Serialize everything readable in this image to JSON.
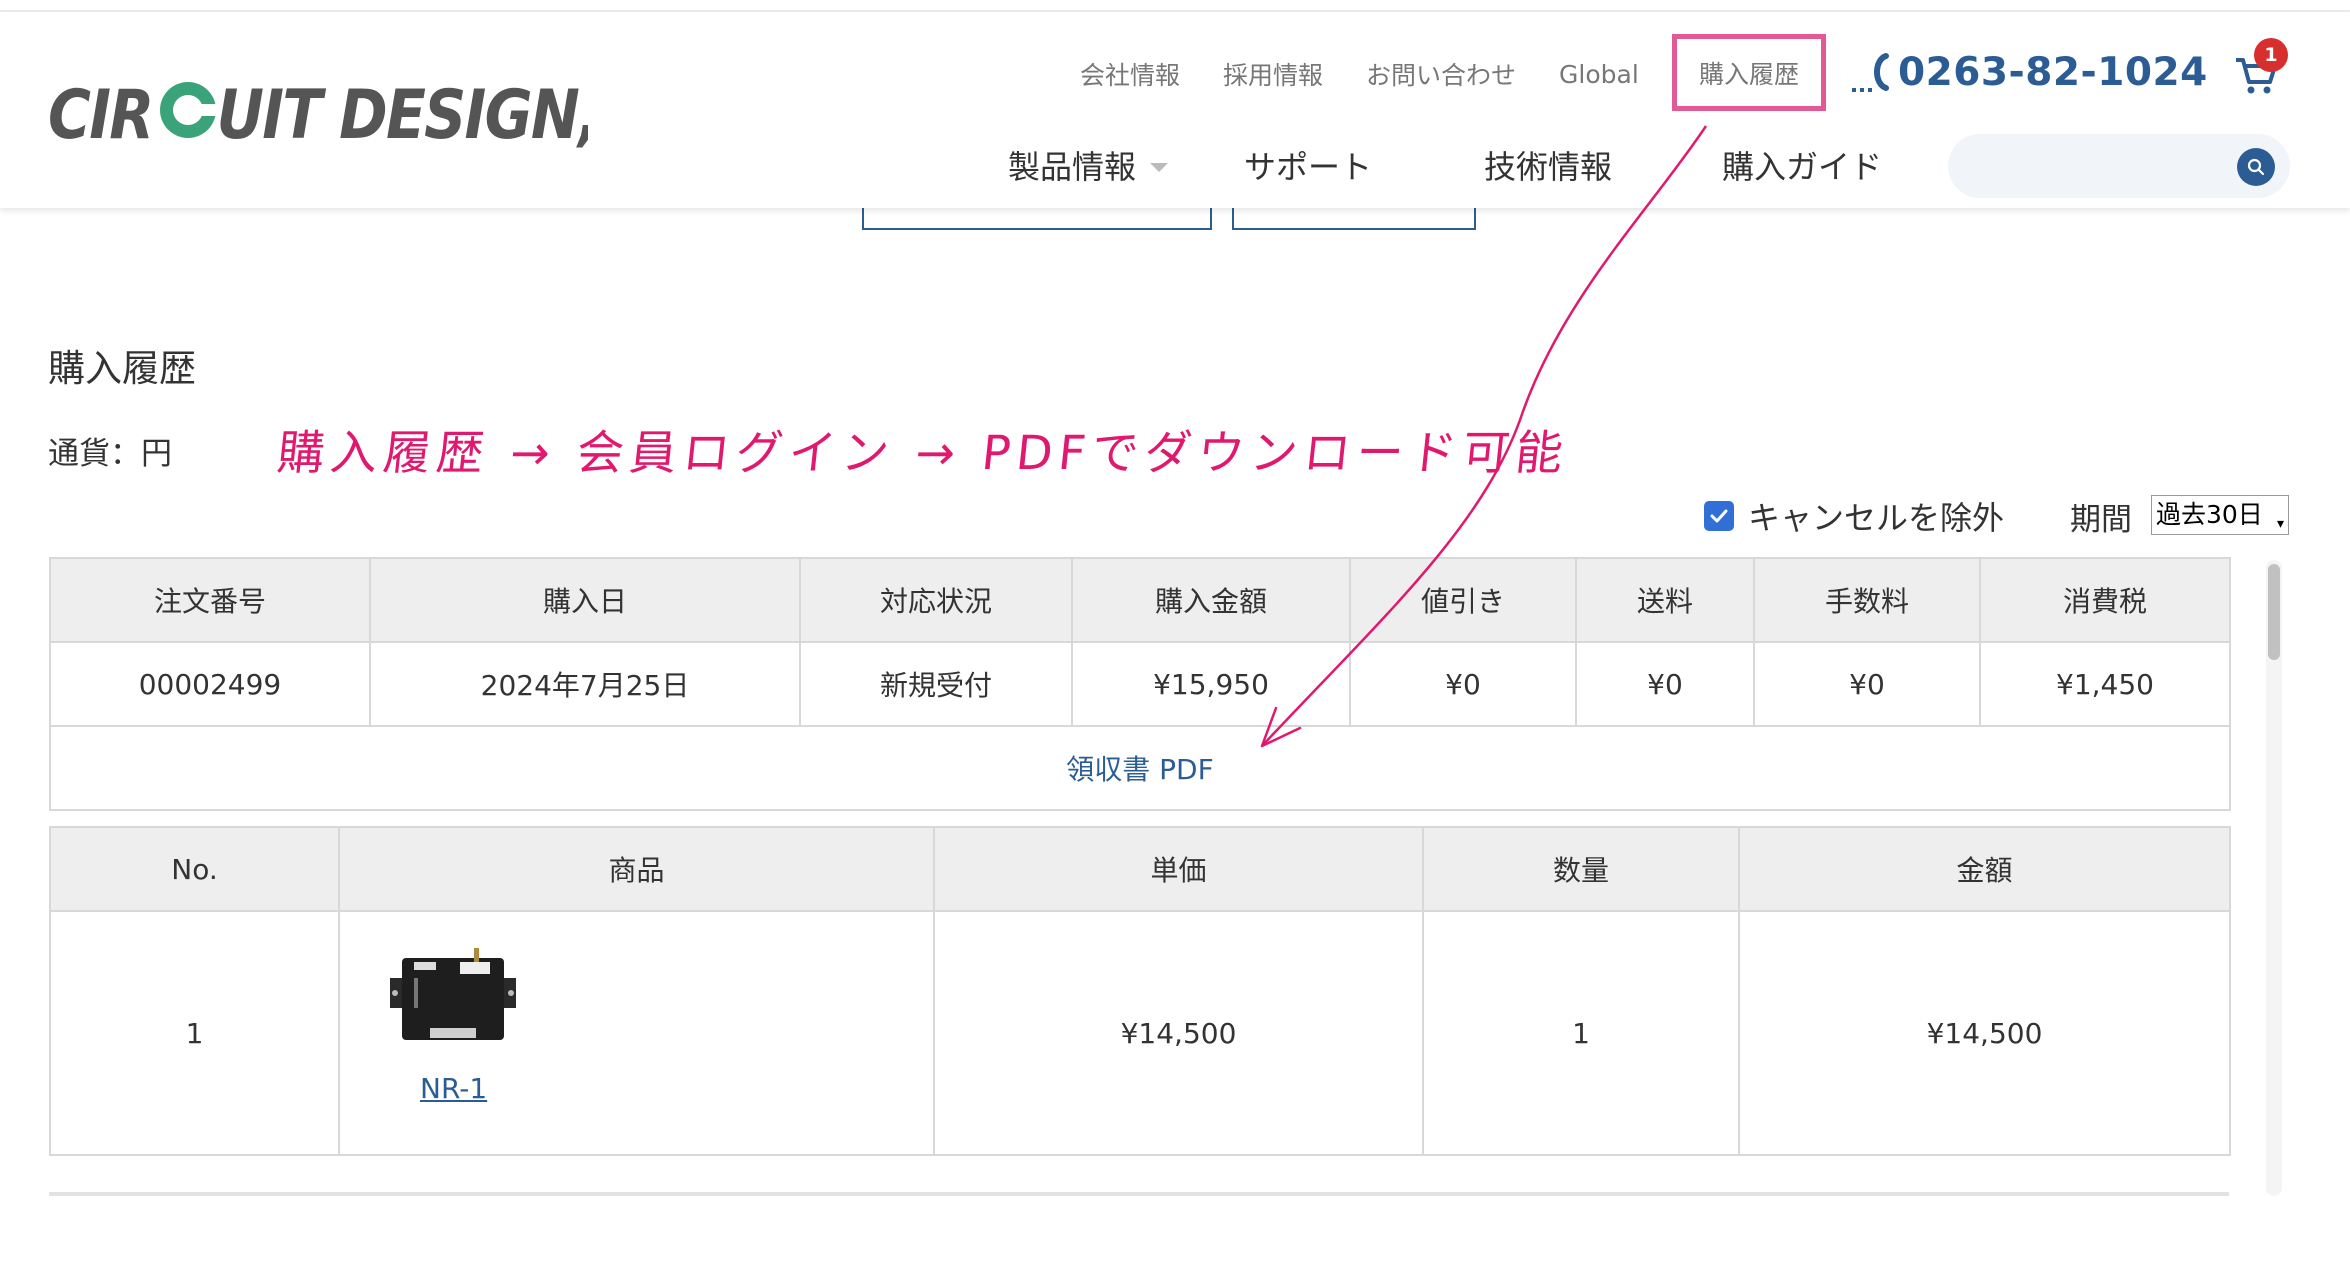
{
  "header": {
    "logo_text": "CIRCUIT DESIGN, INC.",
    "utility_links": [
      "会社情報",
      "採用情報",
      "お問い合わせ",
      "Global"
    ],
    "purchase_history_link": "購入履歴",
    "phone": "0263-82-1024",
    "cart_count": "1",
    "main_nav": [
      "製品情報",
      "サポート",
      "技術情報",
      "購入ガイド"
    ],
    "search_placeholder": ""
  },
  "page": {
    "title": "購入履歴",
    "currency_label": "通貨：円",
    "annotation": "購入履歴 → 会員ログイン → PDFでダウンロード可能",
    "exclude_cancel_label": "キャンセルを除外",
    "exclude_cancel_checked": true,
    "period_label": "期間",
    "period_value": "過去30日"
  },
  "orders": {
    "headers": [
      "注文番号",
      "購入日",
      "対応状況",
      "購入金額",
      "値引き",
      "送料",
      "手数料",
      "消費税"
    ],
    "row": [
      "00002499",
      "2024年7月25日",
      "新規受付",
      "¥15,950",
      "¥0",
      "¥0",
      "¥0",
      "¥1,450"
    ],
    "receipt_link": "領収書 PDF"
  },
  "items": {
    "headers": [
      "No.",
      "商品",
      "単価",
      "数量",
      "金額"
    ],
    "row": {
      "no": "1",
      "product": "NR-1",
      "unit_price": "¥14,500",
      "qty": "1",
      "amount": "¥14,500"
    }
  },
  "colors": {
    "accent": "#2b5d94",
    "highlight": "#e25a94",
    "annotation": "#e0196e",
    "badge": "#d72e2e"
  },
  "icons": [
    "phone-icon",
    "cart-icon",
    "search-icon",
    "chevron-down-icon",
    "checkbox-checked-icon"
  ]
}
